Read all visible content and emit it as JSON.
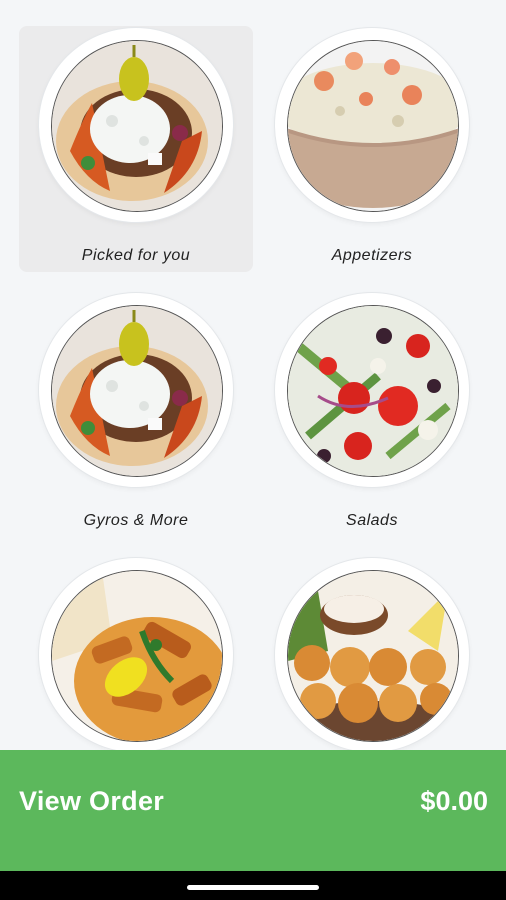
{
  "categories": [
    {
      "label": "Picked for you",
      "image": "gyro-pita-image",
      "selected": true
    },
    {
      "label": "Appetizers",
      "image": "potato-salad-bowl-image",
      "selected": false
    },
    {
      "label": "Gyros & More",
      "image": "gyro-pita-image",
      "selected": false
    },
    {
      "label": "Salads",
      "image": "greek-salad-image",
      "selected": false
    },
    {
      "label": "",
      "image": "grilled-chicken-pita-image",
      "selected": false
    },
    {
      "label": "",
      "image": "fried-bites-image",
      "selected": false
    }
  ],
  "order_bar": {
    "label": "View Order",
    "total": "$0.00"
  },
  "colors": {
    "accent": "#5cb85c",
    "background": "#f4f6f8",
    "selected_tile": "#ebebec"
  }
}
